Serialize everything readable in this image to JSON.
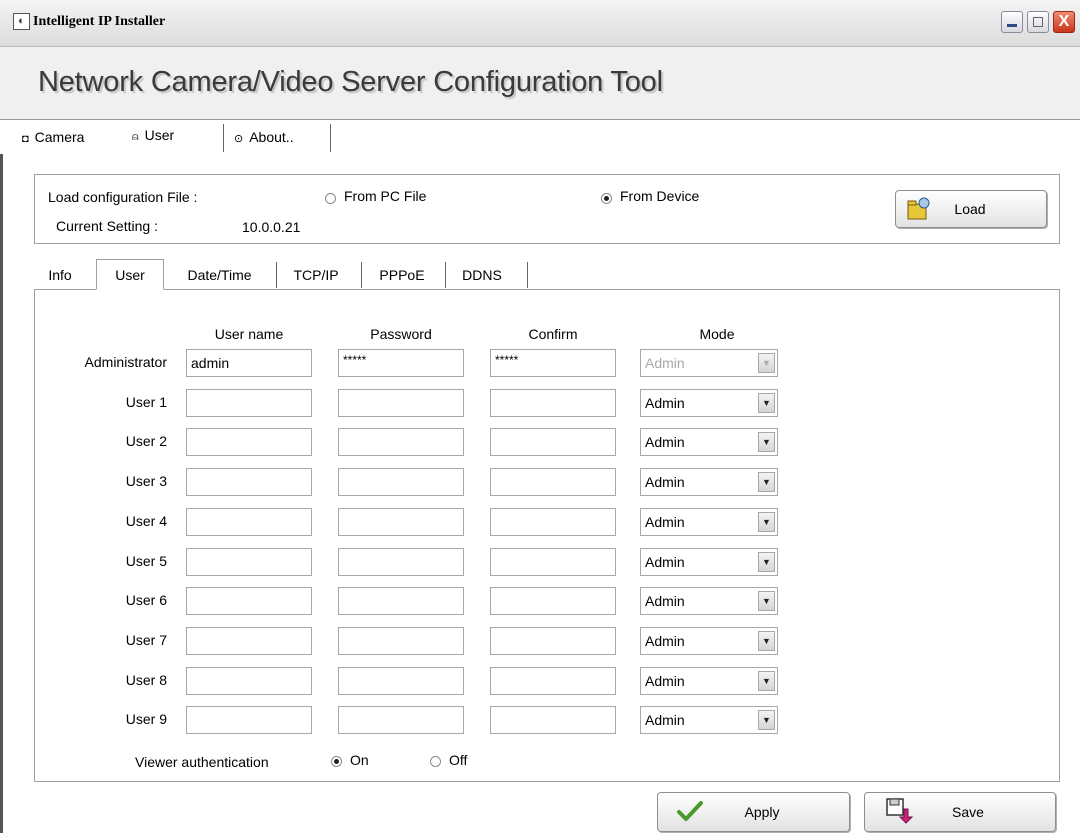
{
  "window": {
    "title": "Intelligent IP Installer",
    "close_glyph": "X"
  },
  "header": {
    "title": "Network Camera/Video Server Configuration Tool"
  },
  "main_tabs": [
    {
      "label": "Camera",
      "icon": "camera-icon"
    },
    {
      "label": "User",
      "icon": "user-icon"
    },
    {
      "label": "About..",
      "icon": "info-icon"
    }
  ],
  "load": {
    "config_label": "Load configuration File :",
    "from_pc_label": "From PC File",
    "from_device_label": "From Device",
    "selected_source": "From Device",
    "current_label": "Current Setting :",
    "current_value": "10.0.0.21",
    "load_button": "Load"
  },
  "sub_tabs": [
    "Info",
    "User",
    "Date/Time",
    "TCP/IP",
    "PPPoE",
    "DDNS"
  ],
  "active_sub_tab": "User",
  "columns": {
    "username": "User name",
    "password": "Password",
    "confirm": "Confirm",
    "mode": "Mode"
  },
  "users": [
    {
      "label": "Administrator",
      "username": "admin",
      "password": "*****",
      "confirm": "*****",
      "mode": "Admin",
      "mode_disabled": true
    },
    {
      "label": "User 1",
      "username": "",
      "password": "",
      "confirm": "",
      "mode": "Admin",
      "mode_disabled": false
    },
    {
      "label": "User 2",
      "username": "",
      "password": "",
      "confirm": "",
      "mode": "Admin",
      "mode_disabled": false
    },
    {
      "label": "User 3",
      "username": "",
      "password": "",
      "confirm": "",
      "mode": "Admin",
      "mode_disabled": false
    },
    {
      "label": "User 4",
      "username": "",
      "password": "",
      "confirm": "",
      "mode": "Admin",
      "mode_disabled": false
    },
    {
      "label": "User 5",
      "username": "",
      "password": "",
      "confirm": "",
      "mode": "Admin",
      "mode_disabled": false
    },
    {
      "label": "User 6",
      "username": "",
      "password": "",
      "confirm": "",
      "mode": "Admin",
      "mode_disabled": false
    },
    {
      "label": "User 7",
      "username": "",
      "password": "",
      "confirm": "",
      "mode": "Admin",
      "mode_disabled": false
    },
    {
      "label": "User 8",
      "username": "",
      "password": "",
      "confirm": "",
      "mode": "Admin",
      "mode_disabled": false
    },
    {
      "label": "User 9",
      "username": "",
      "password": "",
      "confirm": "",
      "mode": "Admin",
      "mode_disabled": false
    }
  ],
  "viewer_auth": {
    "label": "Viewer authentication",
    "on_label": "On",
    "off_label": "Off",
    "selected": "On"
  },
  "buttons": {
    "apply": "Apply",
    "save": "Save"
  },
  "colors": {
    "apply_check": "#4a9a2a",
    "save_arrow": "#c8247a",
    "load_icon": "#d8b820"
  }
}
